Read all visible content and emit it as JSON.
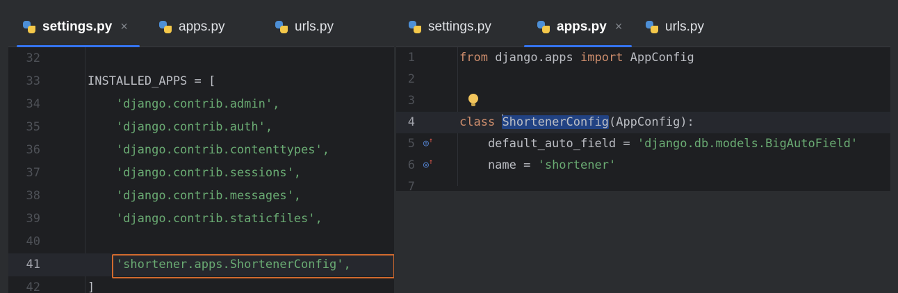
{
  "left_pane": {
    "tabs": [
      {
        "label": "settings.py",
        "active": true,
        "close": "×"
      },
      {
        "label": "apps.py",
        "active": false
      },
      {
        "label": "urls.py",
        "active": false
      }
    ],
    "lines": [
      {
        "num": "32",
        "code": ""
      },
      {
        "num": "33",
        "code": "INSTALLED_APPS = ["
      },
      {
        "num": "34",
        "code": "    'django.contrib.admin',"
      },
      {
        "num": "35",
        "code": "    'django.contrib.auth',"
      },
      {
        "num": "36",
        "code": "    'django.contrib.contenttypes',"
      },
      {
        "num": "37",
        "code": "    'django.contrib.sessions',"
      },
      {
        "num": "38",
        "code": "    'django.contrib.messages',"
      },
      {
        "num": "39",
        "code": "    'django.contrib.staticfiles',"
      },
      {
        "num": "40",
        "code": ""
      },
      {
        "num": "41",
        "code": "    'shortener.apps.ShortenerConfig',"
      },
      {
        "num": "42",
        "code": "]"
      }
    ]
  },
  "right_pane": {
    "tabs": [
      {
        "label": "settings.py",
        "active": false
      },
      {
        "label": "apps.py",
        "active": true,
        "close": "×"
      },
      {
        "label": "urls.py",
        "active": false
      }
    ],
    "lines": [
      {
        "num": "1",
        "kw1": "from",
        "mid": " django.apps ",
        "kw2": "import",
        "rest": " AppConfig"
      },
      {
        "num": "2"
      },
      {
        "num": "3"
      },
      {
        "num": "4",
        "kw": "class",
        "ident": "ShortenerConfig",
        "rest": "(AppConfig):"
      },
      {
        "num": "5",
        "pre": "    default_auto_field = ",
        "str": "'django.db.models.BigAutoField'"
      },
      {
        "num": "6",
        "pre": "    name = ",
        "str": "'shortener'"
      },
      {
        "num": "7"
      }
    ]
  },
  "colors": {
    "keyword": "#cf8e6d",
    "string": "#6aab73",
    "highlight_box": "#d26a2e",
    "tab_underline": "#3574f0"
  }
}
